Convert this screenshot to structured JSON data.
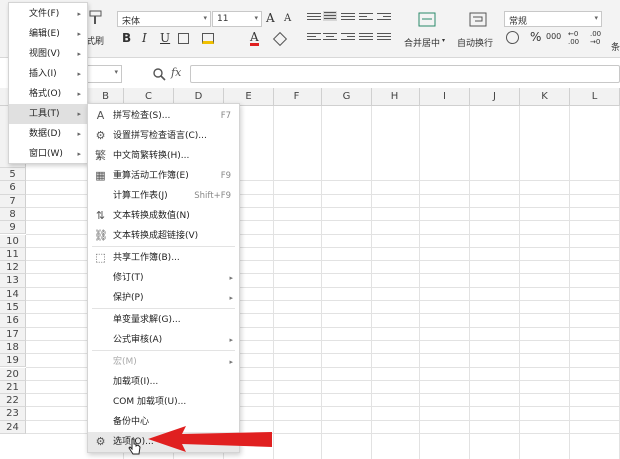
{
  "ribbon": {
    "format_painter": "式刷",
    "font_name": "宋体",
    "font_size": "11",
    "grow_font": "A",
    "shrink_font": "A",
    "bold": "B",
    "italic": "I",
    "underline": "U",
    "font_color": "A",
    "merge_center": "合并居中",
    "wrap_text": "自动换行",
    "number_format": "常规",
    "percent": "%",
    "thousands": "000",
    "cond_fmt": "条"
  },
  "formula_bar": {
    "fx": "fx"
  },
  "columns": [
    "B",
    "C",
    "D",
    "E",
    "F",
    "G",
    "H",
    "I",
    "J",
    "K",
    "L"
  ],
  "rows": [
    "5",
    "6",
    "7",
    "8",
    "9",
    "10",
    "11",
    "12",
    "13",
    "14",
    "15",
    "16",
    "17",
    "18",
    "19",
    "20",
    "21",
    "22",
    "23",
    "24"
  ],
  "main_menu": [
    {
      "label": "文件(F)",
      "arrow": "▸"
    },
    {
      "label": "编辑(E)",
      "arrow": "▸"
    },
    {
      "label": "视图(V)",
      "arrow": "▸"
    },
    {
      "label": "插入(I)",
      "arrow": "▸"
    },
    {
      "label": "格式(O)",
      "arrow": "▸"
    },
    {
      "label": "工具(T)",
      "arrow": "▸"
    },
    {
      "label": "数据(D)",
      "arrow": "▸"
    },
    {
      "label": "窗口(W)",
      "arrow": "▸"
    }
  ],
  "tools_menu": [
    {
      "label": "拼写检查(S)...",
      "shortcut": "F7"
    },
    {
      "label": "设置拼写检查语言(C)..."
    },
    {
      "label": "中文简繁转换(H)..."
    },
    {
      "label": "重算活动工作簿(E)",
      "shortcut": "F9"
    },
    {
      "label": "计算工作表(J)",
      "shortcut": "Shift+F9"
    },
    {
      "label": "文本转换成数值(N)"
    },
    {
      "label": "文本转换成超链接(V)"
    },
    {
      "label": "共享工作簿(B)..."
    },
    {
      "label": "修订(T)",
      "arrow": "▸"
    },
    {
      "label": "保护(P)",
      "arrow": "▸"
    },
    {
      "label": "单变量求解(G)..."
    },
    {
      "label": "公式审核(A)",
      "arrow": "▸"
    },
    {
      "label": "宏(M)",
      "arrow": "▸"
    },
    {
      "label": "加载项(I)..."
    },
    {
      "label": "COM 加载项(U)..."
    },
    {
      "label": "备份中心"
    },
    {
      "label": "选项(O)..."
    }
  ],
  "colors": {
    "arrow": "#e02020",
    "highlight": "#e0e0e0"
  }
}
